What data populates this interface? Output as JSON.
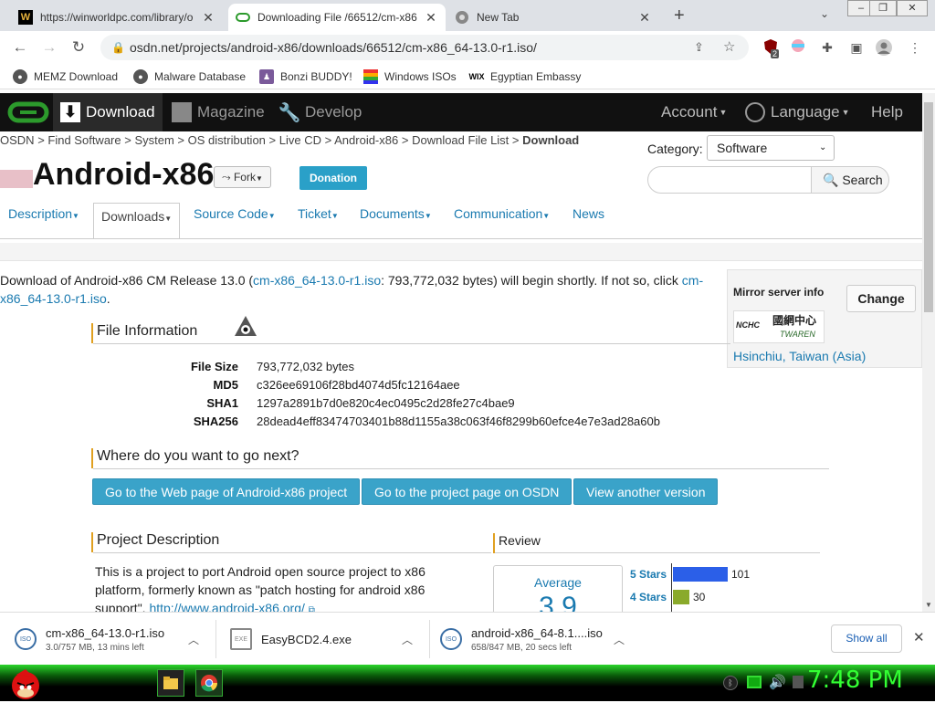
{
  "browser": {
    "tabs": [
      {
        "title": "https://winworldpc.com/library/o",
        "favicon": "W"
      },
      {
        "title": "Downloading File /66512/cm-x86",
        "favicon": "osdn-icon"
      },
      {
        "title": "New Tab",
        "favicon": "chrome-icon"
      }
    ],
    "url": "osdn.net/projects/android-x86/downloads/66512/cm-x86_64-13.0-r1.iso/",
    "ext_badge": "2",
    "bookmarks": [
      {
        "label": "MEMZ Download",
        "icon": "globe-icon"
      },
      {
        "label": "Malware Database",
        "icon": "globe-icon"
      },
      {
        "label": "Bonzi BUDDY!",
        "icon": "bonzi-icon"
      },
      {
        "label": "Windows ISOs",
        "icon": "windows-icon"
      },
      {
        "label": "Egyptian Embassy",
        "icon": "wix-icon"
      }
    ]
  },
  "site": {
    "nav": {
      "download": "Download",
      "magazine": "Magazine",
      "develop": "Develop",
      "account": "Account",
      "language": "Language",
      "help": "Help"
    },
    "breadcrumb": {
      "osdn": "OSDN",
      "find": "Find Software",
      "system": "System",
      "os": "OS distribution",
      "live": "Live CD",
      "android": "Android-x86",
      "list": "Download File List",
      "current": "Download",
      "sep": ">"
    },
    "category_label": "Category:",
    "category_value": "Software",
    "search_button": "Search",
    "project_title": "Android-x86",
    "fork_label": "Fork",
    "donation_label": "Donation",
    "tabs": [
      "Description",
      "Downloads",
      "Source Code",
      "Ticket",
      "Documents",
      "Communication",
      "News"
    ],
    "download_msg": {
      "pre": "Download of Android-x86 CM Release 13.0 (",
      "file_link": "cm-x86_64-13.0-r1.iso",
      "mid": ": 793,772,032 bytes) will begin shortly. If not so, click",
      "click_link": "cm-x86_64-13.0-r1.iso",
      "dot": "."
    },
    "mirror": {
      "title": "Mirror server info",
      "change": "Change",
      "logo_text": "國網中心",
      "logo_sub": "NCHC",
      "logo_sub2": "TWAREN",
      "location": "Hsinchiu, Taiwan (Asia)"
    },
    "file_info": {
      "heading": "File Information",
      "rows": [
        {
          "k": "File Size",
          "v": "793,772,032 bytes"
        },
        {
          "k": "MD5",
          "v": "c326ee69106f28bd4074d5fc12164aee"
        },
        {
          "k": "SHA1",
          "v": "1297a2891b7d0e820c4ec0495c2d28fe27c4bae9"
        },
        {
          "k": "SHA256",
          "v": "28dead4eff83474703401b88d1155a38c063f46f8299b60efce4e7e3ad28a60b"
        }
      ]
    },
    "next": {
      "heading": "Where do you want to go next?",
      "buttons": [
        "Go to the Web page of Android-x86 project",
        "Go to the project page on OSDN",
        "View another version"
      ]
    },
    "project_desc": {
      "heading": "Project Description",
      "text1": "This is a project to port Android open source project to x86",
      "text2": "platform, formerly known as \"patch hosting for android x86",
      "text3": "support\".",
      "link": "http://www.android-x86.org/"
    },
    "review": {
      "heading": "Review",
      "average_label": "Average",
      "average_value": "3.9",
      "bars": [
        {
          "label": "5 Stars",
          "count": "101",
          "color": "#2b5fe8",
          "fraction": 1.0
        },
        {
          "label": "4 Stars",
          "count": "30",
          "color": "#8aaa2b",
          "fraction": 0.3
        }
      ]
    }
  },
  "downloads": [
    {
      "name": "cm-x86_64-13.0-r1.iso",
      "status": "3.0/757 MB, 13 mins left"
    },
    {
      "name": "EasyBCD2.4.exe",
      "status": ""
    },
    {
      "name": "android-x86_64-8.1....iso",
      "status": "658/847 MB, 20 secs left"
    }
  ],
  "show_all": "Show all",
  "taskbar": {
    "clock": "7:48 PM"
  }
}
